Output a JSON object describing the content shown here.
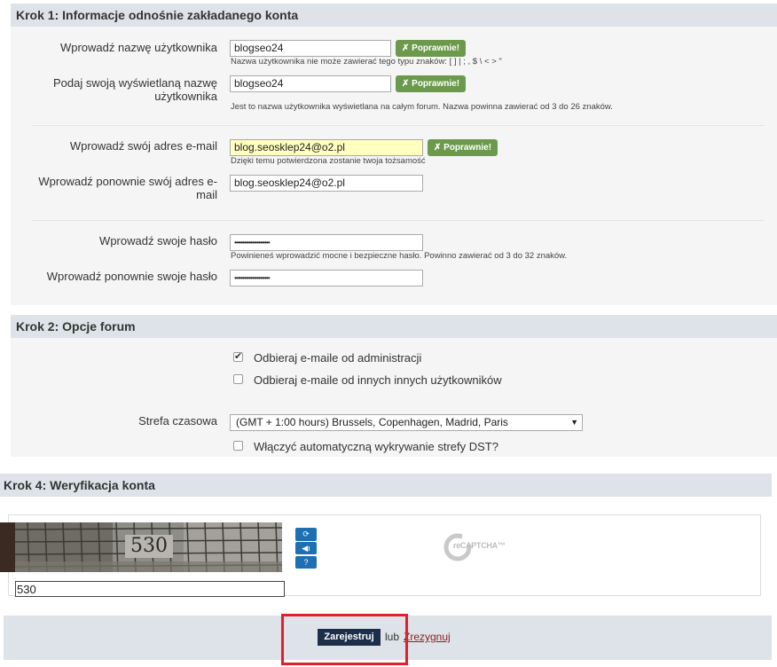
{
  "step1": {
    "title": "Krok 1: Informacje odnośnie zakładanego konta",
    "username_label": "Wprowadź nazwę użytkownika",
    "username_value": "blogseo24",
    "username_ok": "✗ Poprawnie!",
    "username_hint": "Nazwa użytkownika nie może zawierać tego typu znaków: [ ] | ; , $ \\ < > \"",
    "display_label": "Podaj swoją wyświetlaną nazwę użytkownika",
    "display_value": "blogseo24",
    "display_ok": "✗ Poprawnie!",
    "display_hint": "Jest to nazwa użytkownika wyświetlana na całym forum. Nazwa powinna zawierać od 3 do 26 znaków.",
    "email_label": "Wprowadź swój adres e-mail",
    "email_value": "blog.seosklep24@o2.pl",
    "email_ok": "✗ Poprawnie!",
    "email_hint": "Dzięki temu potwierdzona zostanie twoja tożsamość",
    "email2_label": "Wprowadź ponownie swój adres e-mail",
    "email2_value": "blog.seosklep24@o2.pl",
    "password_label": "Wprowadź swoje hasło",
    "password_value": "••••••••••••••••••••••",
    "password_hint": "Powinieneś wprowadzić mocne i bezpieczne hasło. Powinno zawierać od 3 do 32 znaków.",
    "password2_label": "Wprowadź ponownie swoje hasło",
    "password2_value": "••••••••••••••••••••••"
  },
  "step2": {
    "title": "Krok 2: Opcje forum",
    "admin_email_label": "Odbieraj e-maile od administracji",
    "admin_email_checked": true,
    "user_email_label": "Odbieraj e-maile od innych innych użytkowników",
    "user_email_checked": false,
    "timezone_label": "Strefa czasowa",
    "timezone_value": "(GMT + 1:00 hours) Brussels, Copenhagen, Madrid, Paris",
    "dst_label": "Włączyć automatyczną wykrywanie strefy DST?",
    "dst_checked": false
  },
  "step4": {
    "title": "Krok 4: Weryfikacja konta",
    "captcha_text": "530",
    "captcha_input": "530",
    "recaptcha_logo": "reCAPTCHA™",
    "icons": [
      "refresh-icon",
      "audio-icon",
      "help-icon"
    ]
  },
  "footer": {
    "register_label": "Zarejestruj",
    "or_text": "lub",
    "cancel_label": "Zrezygnuj"
  },
  "colors": {
    "section_header": "#dde3e8",
    "ok_button": "#6c9a4c",
    "register_button": "#1b2f4a",
    "highlight": "#e0202a",
    "cancel_link": "#8a1f1f"
  }
}
